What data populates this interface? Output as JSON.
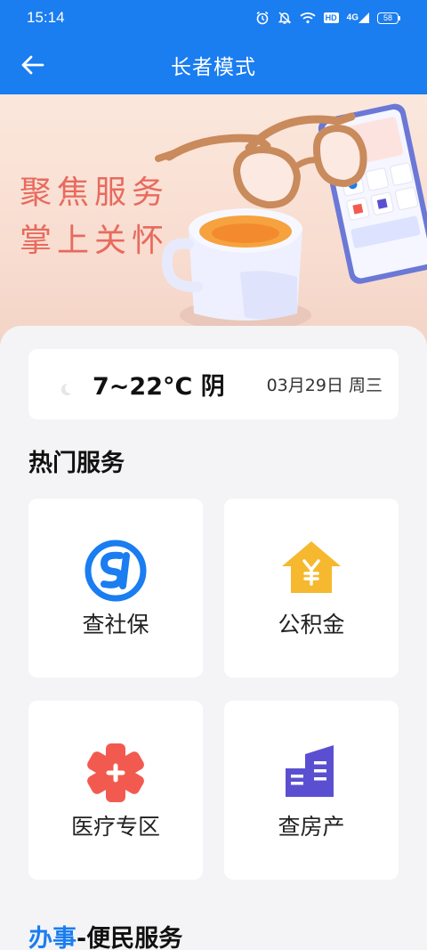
{
  "status_bar": {
    "time": "15:14",
    "hd": "HD",
    "network": "4G",
    "battery": "58",
    "icons": [
      "alarm-icon",
      "mute-icon",
      "wifi-icon",
      "hd-icon",
      "signal-icon",
      "battery-icon"
    ]
  },
  "nav": {
    "back_icon": "back-arrow-icon",
    "title": "长者模式"
  },
  "banner": {
    "line1": "聚焦服务",
    "line2": "掌上关怀"
  },
  "weather": {
    "icon": "moon-icon",
    "temp": "7~22°C 阴",
    "date": "03月29日 周三"
  },
  "hot_services": {
    "title": "热门服务",
    "items": [
      {
        "label": "查社保",
        "icon": "social-security-icon",
        "color": "#1a7df0"
      },
      {
        "label": "公积金",
        "icon": "housing-fund-icon",
        "color": "#f6b82e"
      },
      {
        "label": "医疗专区",
        "icon": "medical-icon",
        "color": "#f25a50"
      },
      {
        "label": "查房产",
        "icon": "property-icon",
        "color": "#5b4fd1"
      }
    ]
  },
  "section2": {
    "accent": "办事",
    "rest": "-便民服务"
  },
  "colors": {
    "primary": "#1a7df0",
    "background": "#f4f4f6",
    "card": "#ffffff"
  }
}
